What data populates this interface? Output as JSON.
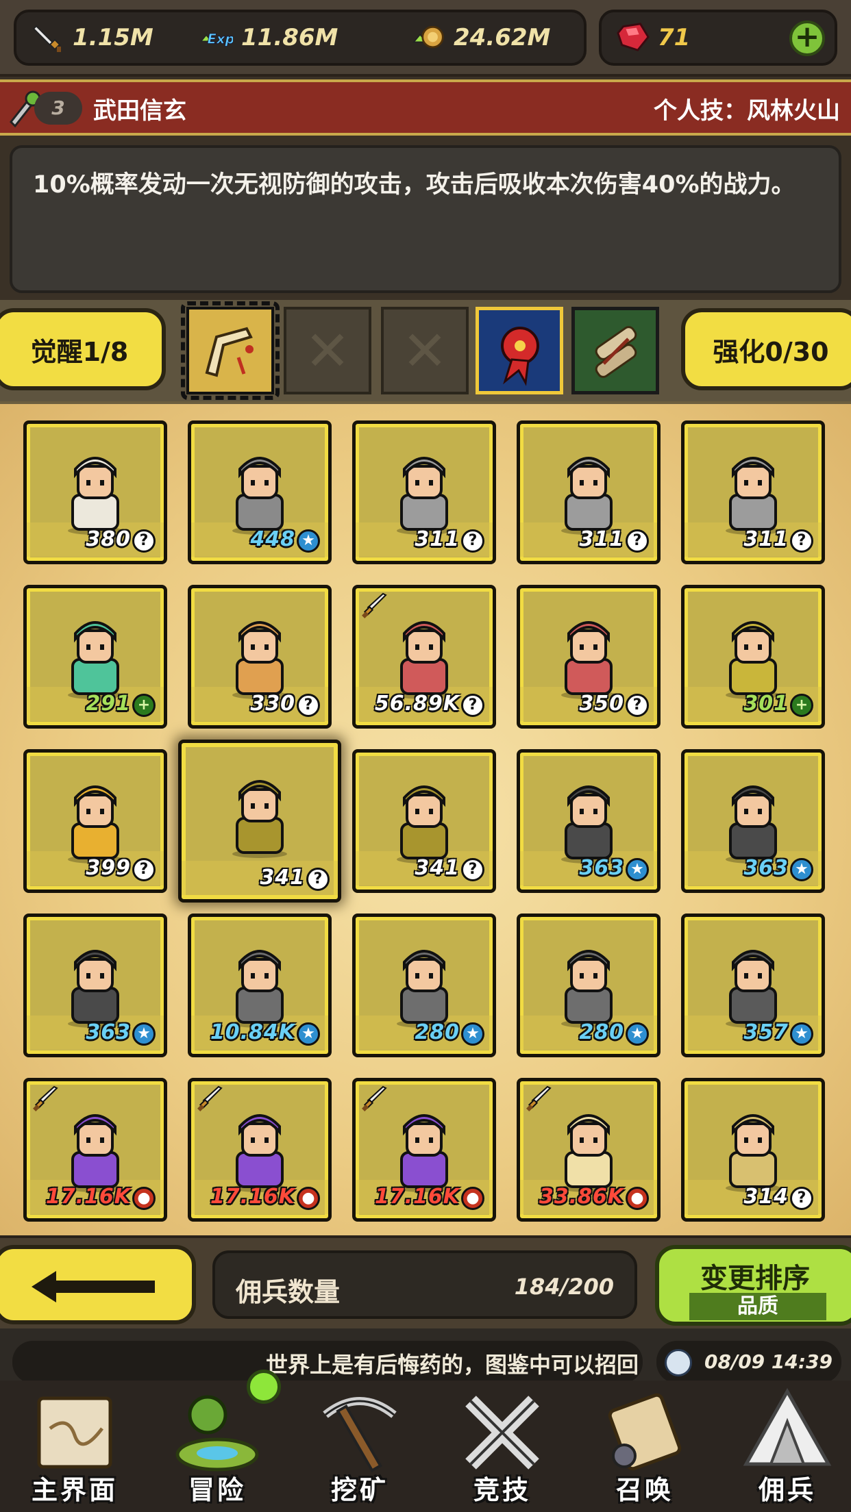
{
  "resources": {
    "attack": {
      "icon": "sword-icon",
      "value": "1.15M"
    },
    "exp": {
      "icon": "exp-icon",
      "value": "11.86M"
    },
    "gold": {
      "icon": "coin-icon",
      "value": "24.62M"
    },
    "gems": {
      "icon": "ruby-icon",
      "value": "71"
    },
    "add_label": "+"
  },
  "hero": {
    "level": "3",
    "name": "武田信玄",
    "skill": "个人技：风林火山",
    "description": "10%概率发动一次无视防御的攻击，攻击后吸收本次伤害40%的战力。"
  },
  "equip": {
    "awaken_label": "觉醒1/8",
    "enhance_label": "强化0/30",
    "empty_mark": "✕"
  },
  "mercenaries": [
    {
      "value": "380",
      "badge": "?",
      "tone": "white",
      "sword": false,
      "color": "#ece8dc"
    },
    {
      "value": "448",
      "badge": "★",
      "tone": "blue",
      "sword": false,
      "color": "#8a8a8a"
    },
    {
      "value": "311",
      "badge": "?",
      "tone": "white",
      "sword": false,
      "color": "#9c9c9c"
    },
    {
      "value": "311",
      "badge": "?",
      "tone": "white",
      "sword": false,
      "color": "#9c9c9c"
    },
    {
      "value": "311",
      "badge": "?",
      "tone": "white",
      "sword": false,
      "color": "#9c9c9c"
    },
    {
      "value": "291",
      "badge": "+",
      "tone": "green",
      "sword": false,
      "color": "#4fc49a"
    },
    {
      "value": "330",
      "badge": "?",
      "tone": "white",
      "sword": false,
      "color": "#e0a050"
    },
    {
      "value": "56.89K",
      "badge": "?",
      "tone": "white",
      "sword": true,
      "color": "#d05a5a"
    },
    {
      "value": "350",
      "badge": "?",
      "tone": "white",
      "sword": false,
      "color": "#d05a5a"
    },
    {
      "value": "301",
      "badge": "+",
      "tone": "green",
      "sword": false,
      "color": "#c9b63a"
    },
    {
      "value": "399",
      "badge": "?",
      "tone": "white",
      "sword": false,
      "color": "#e8b030"
    },
    {
      "value": "341",
      "badge": "?",
      "tone": "white",
      "sword": false,
      "color": "#a8952e",
      "selected": true
    },
    {
      "value": "341",
      "badge": "?",
      "tone": "white",
      "sword": false,
      "color": "#a8952e"
    },
    {
      "value": "363",
      "badge": "★",
      "tone": "blue",
      "sword": false,
      "color": "#4a4a4a"
    },
    {
      "value": "363",
      "badge": "★",
      "tone": "blue",
      "sword": false,
      "color": "#4a4a4a"
    },
    {
      "value": "363",
      "badge": "★",
      "tone": "blue",
      "sword": false,
      "color": "#4a4a4a"
    },
    {
      "value": "10.84K",
      "badge": "★",
      "tone": "blue",
      "sword": false,
      "color": "#6e6e6e"
    },
    {
      "value": "280",
      "badge": "★",
      "tone": "blue",
      "sword": false,
      "color": "#6e6e6e"
    },
    {
      "value": "280",
      "badge": "★",
      "tone": "blue",
      "sword": false,
      "color": "#6e6e6e"
    },
    {
      "value": "357",
      "badge": "★",
      "tone": "blue",
      "sword": false,
      "color": "#5a5a5a"
    },
    {
      "value": "17.16K",
      "badge": "●",
      "tone": "red",
      "sword": true,
      "color": "#8a4fd0"
    },
    {
      "value": "17.16K",
      "badge": "●",
      "tone": "red",
      "sword": true,
      "color": "#8a4fd0"
    },
    {
      "value": "17.16K",
      "badge": "●",
      "tone": "red",
      "sword": true,
      "color": "#8a4fd0"
    },
    {
      "value": "33.86K",
      "badge": "●",
      "tone": "red",
      "sword": true,
      "color": "#f0e0a8"
    },
    {
      "value": "314",
      "badge": "?",
      "tone": "white",
      "sword": false,
      "color": "#d8c070"
    }
  ],
  "controls": {
    "back_icon": "arrow-left-icon",
    "count_label": "佣兵数量",
    "count_value": "184/200",
    "sort_label": "变更排序",
    "sort_sub": "品质"
  },
  "ticker": {
    "message": "世界上是有后悔药的，图鉴中可以招回",
    "time": "08/09 14:39"
  },
  "nav": [
    {
      "label": "主界面",
      "icon": "map-icon"
    },
    {
      "label": "冒险",
      "icon": "island-icon"
    },
    {
      "label": "挖矿",
      "icon": "pickaxe-icon"
    },
    {
      "label": "竞技",
      "icon": "crossed-swords-icon"
    },
    {
      "label": "召唤",
      "icon": "scroll-icon"
    },
    {
      "label": "佣兵",
      "icon": "tent-icon"
    }
  ]
}
